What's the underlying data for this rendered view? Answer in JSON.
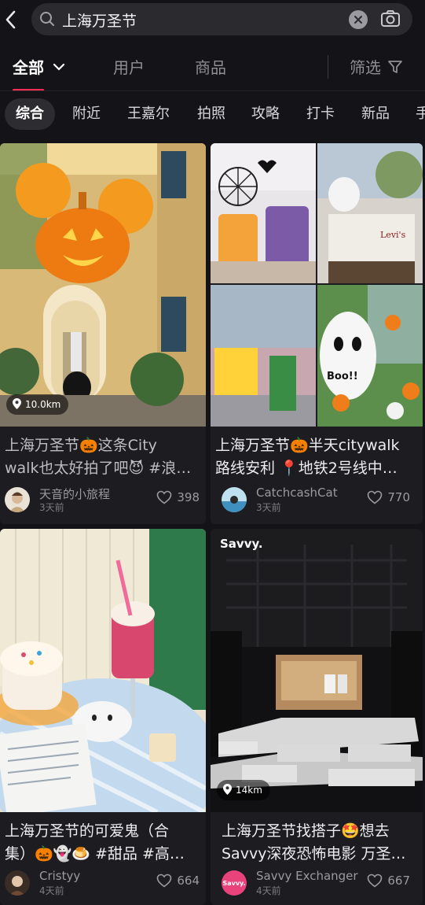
{
  "search": {
    "query": "上海万圣节"
  },
  "tabs": {
    "all": "全部",
    "users": "用户",
    "products": "商品",
    "filter": "筛选"
  },
  "chips": [
    "综合",
    "附近",
    "王嘉尔",
    "拍照",
    "攻略",
    "打卡",
    "新品",
    "手"
  ],
  "cards": [
    {
      "distance": "10.0km",
      "title_line1": "上海万圣节🎃这条City",
      "title_line2": "walk也太好拍了吧😈 #浪…",
      "author": "天音的小旅程",
      "time": "3天前",
      "likes": "398"
    },
    {
      "distance": "",
      "title_line1": "上海万圣节🎃半天citywalk",
      "title_line2": "路线安利 📍地铁2号线中…",
      "author": "CatchcashCat",
      "time": "3天前",
      "likes": "770"
    },
    {
      "distance": "",
      "title_line1": "上海万圣节的可爱鬼（合",
      "title_line2": "集）🎃👻🍮 #甜品 #高…",
      "author": "Cristyy",
      "time": "4天前",
      "likes": "664"
    },
    {
      "distance": "14km",
      "title_line1": "上海万圣节找搭子🤩想去",
      "title_line2": "Savvy深夜恐怖电影 万圣…",
      "author": "Savvy Exchanger",
      "time": "4天前",
      "likes": "667",
      "image_logo": "Savvy.",
      "avatar_text": "Savvy."
    }
  ],
  "colors": {
    "accent": "#ff2d55",
    "background": "#141418",
    "card": "#1c1c21"
  }
}
